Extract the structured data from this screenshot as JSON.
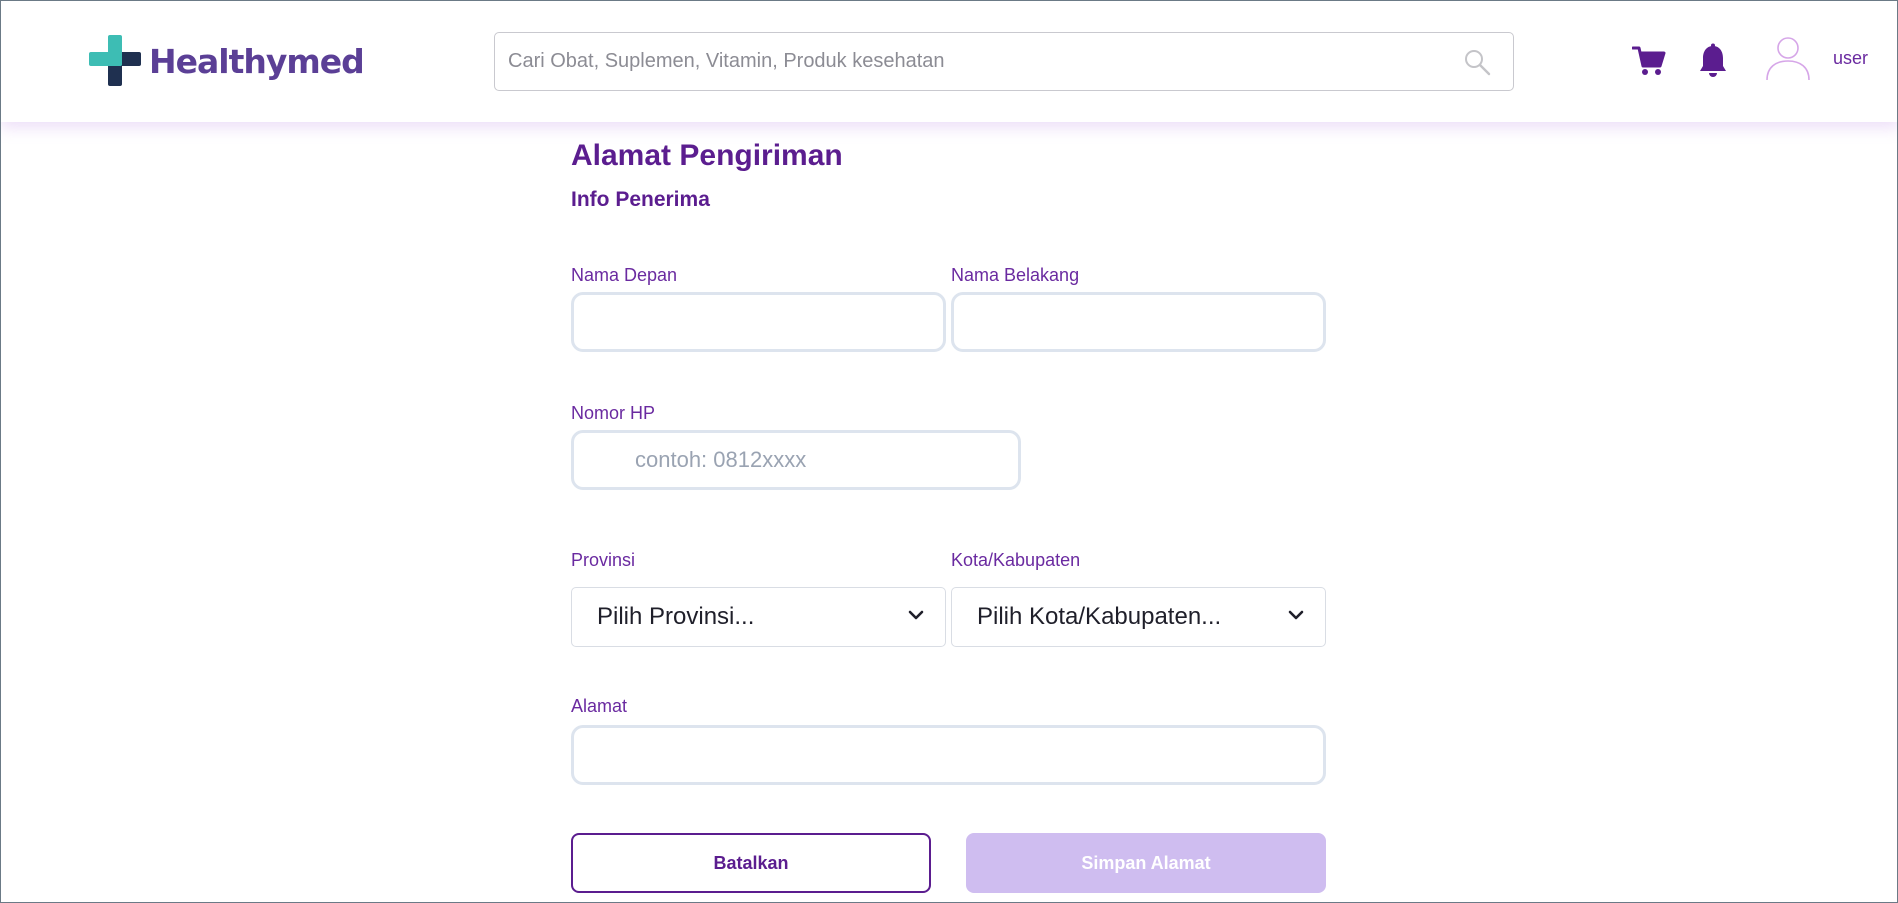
{
  "header": {
    "brand": "Healthymed",
    "search_placeholder": "Cari Obat, Suplemen, Vitamin, Produk kesehatan",
    "user_label": "user"
  },
  "form": {
    "title": "Alamat Pengiriman",
    "section_title": "Info Penerima",
    "first_name": {
      "label": "Nama Depan",
      "value": ""
    },
    "last_name": {
      "label": "Nama Belakang",
      "value": ""
    },
    "phone": {
      "label": "Nomor HP",
      "placeholder": "contoh: 0812xxxx",
      "value": ""
    },
    "province": {
      "label": "Provinsi",
      "selected": "Pilih Provinsi..."
    },
    "city": {
      "label": "Kota/Kabupaten",
      "selected": "Pilih Kota/Kabupaten..."
    },
    "address": {
      "label": "Alamat",
      "value": ""
    },
    "cancel_label": "Batalkan",
    "save_label": "Simpan Alamat"
  },
  "colors": {
    "brand_purple": "#5b1d8f",
    "logo_teal": "#3dbdb4",
    "logo_navy": "#1f3050",
    "save_disabled": "#cfbdf0"
  },
  "icons": {
    "logo": "cross-logo-icon",
    "search": "search-icon",
    "cart": "cart-icon",
    "bell": "bell-icon",
    "avatar": "user-avatar-icon",
    "dropdown": "chevron-down-icon"
  }
}
